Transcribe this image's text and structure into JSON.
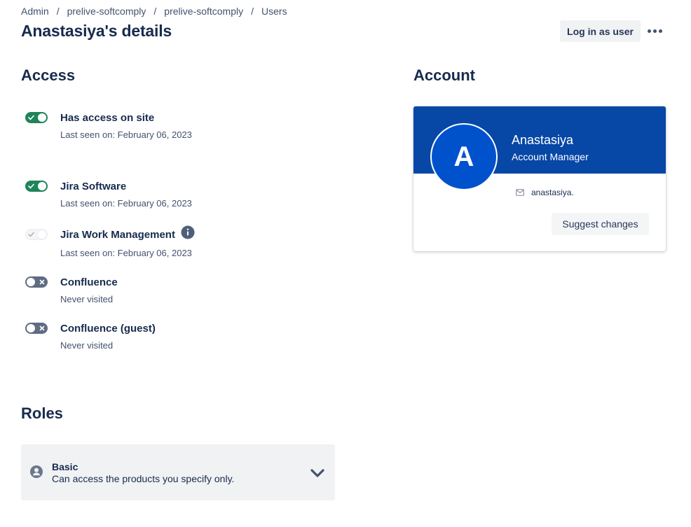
{
  "breadcrumb": {
    "items": [
      "Admin",
      "prelive-softcomply",
      "prelive-softcomply",
      "Users"
    ],
    "separator": "/"
  },
  "page": {
    "title": "Anastasiya's details"
  },
  "header": {
    "login_as_user": "Log in as user",
    "more_icon": "more-horizontal-icon"
  },
  "access": {
    "title": "Access",
    "products": [
      {
        "name": "Has access on site",
        "sub": "Last seen on: February 06, 2023",
        "state": "on"
      },
      {
        "name": "Jira Software",
        "sub": "Last seen on: February 06, 2023",
        "state": "on"
      },
      {
        "name": "Jira Work Management",
        "sub": "Last seen on: February 06, 2023",
        "state": "disabled",
        "icon": "info-icon"
      },
      {
        "name": "Confluence",
        "sub": "Never visited",
        "state": "off"
      },
      {
        "name": "Confluence (guest)",
        "sub": "Never visited",
        "state": "off"
      }
    ]
  },
  "account": {
    "title": "Account",
    "avatar_letter": "A",
    "name": "Anastasiya",
    "role": "Account Manager",
    "email": "anastasiya.",
    "email_icon": "mail-icon",
    "suggest_changes": "Suggest changes"
  },
  "roles": {
    "title": "Roles",
    "role_name": "Basic",
    "role_desc": "Can access the products you specify only.",
    "icon": "person-icon",
    "chevron": "chevron-down-icon"
  },
  "colors": {
    "toggle_on": "#1f845a",
    "toggle_off": "#5e6c84",
    "card_header": "#0747a6",
    "avatar": "#0052cc",
    "text": "#172b4d"
  }
}
